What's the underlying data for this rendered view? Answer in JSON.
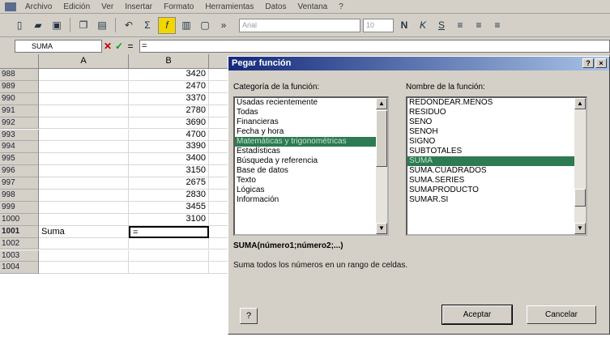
{
  "menubar": {
    "items": [
      "Archivo",
      "Edición",
      "Ver",
      "Insertar",
      "Formato",
      "Herramientas",
      "Datos",
      "Ventana",
      "?"
    ]
  },
  "toolbar": {
    "font_box": "Arial",
    "size_box": "10"
  },
  "formula_bar": {
    "name_box": "SUMA",
    "cancel_glyph": "✕",
    "enter_glyph": "✓",
    "equals_glyph": "=",
    "content": "="
  },
  "grid": {
    "columns": [
      "A",
      "B"
    ],
    "rows": [
      {
        "n": "988",
        "a": "",
        "b": "3420"
      },
      {
        "n": "989",
        "a": "",
        "b": "2470"
      },
      {
        "n": "990",
        "a": "",
        "b": "3370"
      },
      {
        "n": "991",
        "a": "",
        "b": "2780"
      },
      {
        "n": "992",
        "a": "",
        "b": "3690"
      },
      {
        "n": "993",
        "a": "",
        "b": "4700"
      },
      {
        "n": "994",
        "a": "",
        "b": "3390"
      },
      {
        "n": "995",
        "a": "",
        "b": "3400"
      },
      {
        "n": "996",
        "a": "",
        "b": "3150"
      },
      {
        "n": "997",
        "a": "",
        "b": "2675"
      },
      {
        "n": "998",
        "a": "",
        "b": "2830"
      },
      {
        "n": "999",
        "a": "",
        "b": "3455"
      },
      {
        "n": "1000",
        "a": "",
        "b": "3100"
      },
      {
        "n": "1001",
        "a": "Suma",
        "b": "="
      },
      {
        "n": "1002",
        "a": "",
        "b": ""
      },
      {
        "n": "1003",
        "a": "",
        "b": ""
      },
      {
        "n": "1004",
        "a": "",
        "b": ""
      }
    ]
  },
  "dialog": {
    "title": "Pegar función",
    "help_glyph": "?",
    "close_glyph": "×",
    "category_label": "Categoría de la función:",
    "categories": [
      "Usadas recientemente",
      "Todas",
      "Financieras",
      "Fecha y hora",
      "Matemáticas y trigonométricas",
      "Estadísticas",
      "Búsqueda y referencia",
      "Base de datos",
      "Texto",
      "Lógicas",
      "Información"
    ],
    "category_selected": 4,
    "function_label": "Nombre de la función:",
    "functions": [
      "REDONDEAR.MENOS",
      "RESIDUO",
      "SENO",
      "SENOH",
      "SIGNO",
      "SUBTOTALES",
      "SUMA",
      "SUMA.CUADRADOS",
      "SUMA.SERIES",
      "SUMAPRODUCTO",
      "SUMAR.SI"
    ],
    "function_selected": 6,
    "syntax": "SUMA(número1;número2;...)",
    "description": "Suma todos los números en un rango de celdas.",
    "ok_label": "Aceptar",
    "cancel_label": "Cancelar"
  }
}
